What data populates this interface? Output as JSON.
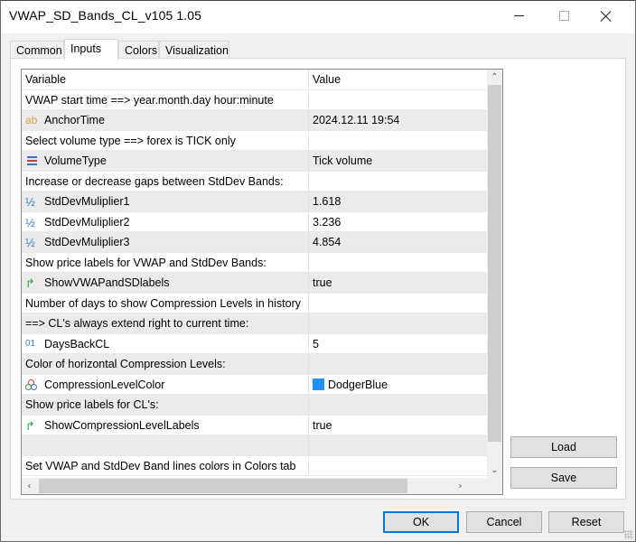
{
  "window": {
    "title": "VWAP_SD_Bands_CL_v105 1.05",
    "controls": {
      "minimize": "minimize-icon",
      "maximize": "maximize-icon",
      "close": "close-icon"
    }
  },
  "tabs": [
    {
      "label": "Common",
      "active": false
    },
    {
      "label": "Inputs",
      "active": true
    },
    {
      "label": "Colors",
      "active": false
    },
    {
      "label": "Visualization",
      "active": false
    }
  ],
  "grid": {
    "columns": {
      "variable": "Variable",
      "value": "Value"
    },
    "rows": [
      {
        "variable": "VWAP start time ==> year.month.day hour:minute",
        "value": "",
        "icon": ""
      },
      {
        "variable": "AnchorTime",
        "value": "2024.12.11 19:54",
        "icon": "string-icon",
        "icon_text": "ab"
      },
      {
        "variable": "Select volume type ==> forex is TICK only",
        "value": "",
        "icon": ""
      },
      {
        "variable": "VolumeType",
        "value": "Tick volume",
        "icon": "enum-icon"
      },
      {
        "variable": "Increase or decrease gaps between StdDev Bands:",
        "value": "",
        "icon": ""
      },
      {
        "variable": "StdDevMuliplier1",
        "value": "1.618",
        "icon": "double-icon",
        "icon_text": "½"
      },
      {
        "variable": "StdDevMuliplier2",
        "value": "3.236",
        "icon": "double-icon",
        "icon_text": "½"
      },
      {
        "variable": "StdDevMuliplier3",
        "value": "4.854",
        "icon": "double-icon",
        "icon_text": "½"
      },
      {
        "variable": "Show price labels for VWAP and StdDev Bands:",
        "value": "",
        "icon": ""
      },
      {
        "variable": "ShowVWAPandSDlabels",
        "value": "true",
        "icon": "bool-icon",
        "icon_text": "↱"
      },
      {
        "variable": "Number of days to show Compression Levels in history",
        "value": "",
        "icon": ""
      },
      {
        "variable": "==> CL's always extend right to current time:",
        "value": "",
        "icon": ""
      },
      {
        "variable": "DaysBackCL",
        "value": "5",
        "icon": "int-icon",
        "icon_text": "01"
      },
      {
        "variable": "Color of horizontal Compression Levels:",
        "value": "",
        "icon": ""
      },
      {
        "variable": "CompressionLevelColor",
        "value": "DodgerBlue",
        "icon": "color-icon",
        "swatch": "#1e90ff"
      },
      {
        "variable": "Show price labels for CL's:",
        "value": "",
        "icon": ""
      },
      {
        "variable": "ShowCompressionLevelLabels",
        "value": "true",
        "icon": "bool-icon",
        "icon_text": "↱"
      },
      {
        "variable": "",
        "value": "",
        "icon": ""
      },
      {
        "variable": "Set VWAP and StdDev Band lines colors in Colors tab",
        "value": "",
        "icon": ""
      }
    ]
  },
  "buttons": {
    "load": "Load",
    "save": "Save",
    "ok": "OK",
    "cancel": "Cancel",
    "reset": "Reset"
  }
}
